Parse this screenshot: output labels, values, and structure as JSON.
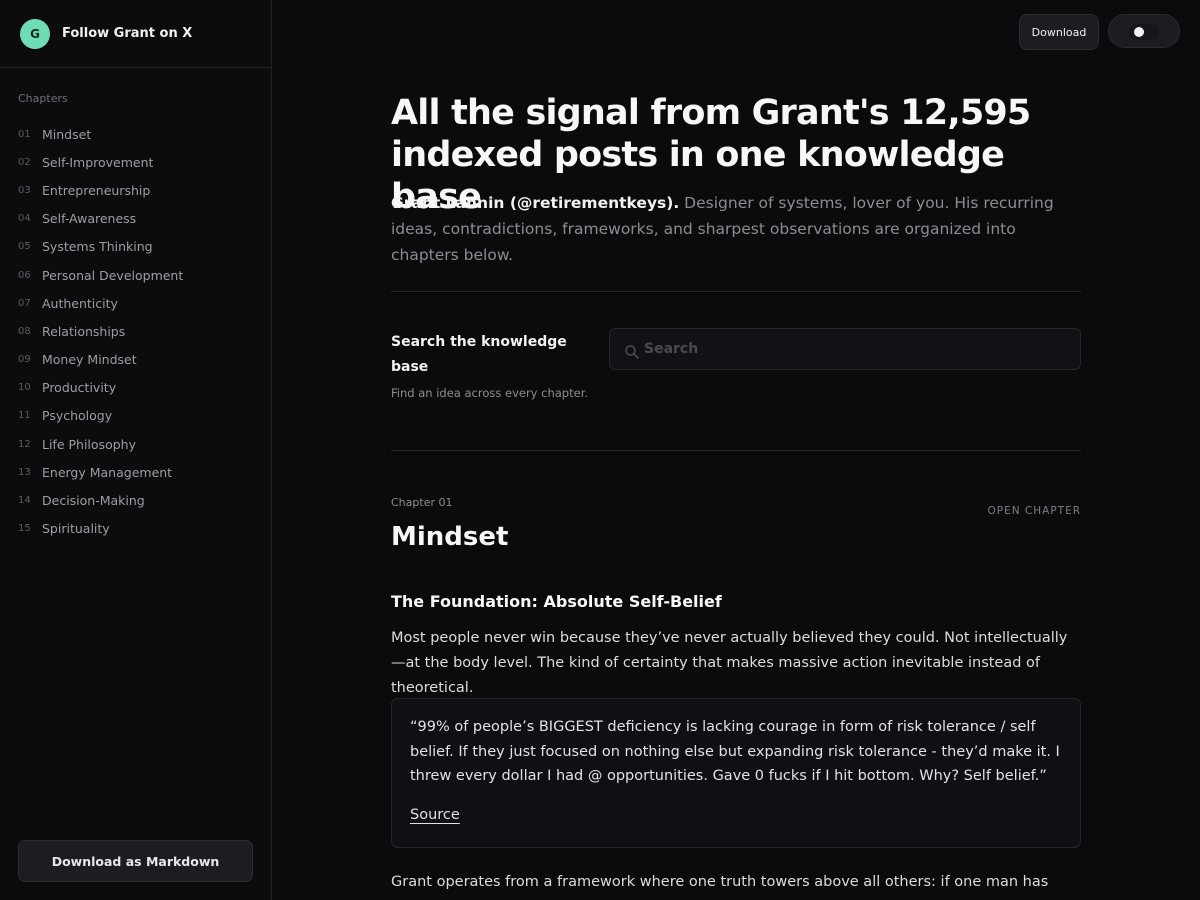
{
  "sidebar": {
    "avatar_letter": "G",
    "follow_label": "Follow Grant on X",
    "section_label": "Chapters",
    "chapters": [
      {
        "num": "01",
        "label": "Mindset"
      },
      {
        "num": "02",
        "label": "Self-Improvement"
      },
      {
        "num": "03",
        "label": "Entrepreneurship"
      },
      {
        "num": "04",
        "label": "Self-Awareness"
      },
      {
        "num": "05",
        "label": "Systems Thinking"
      },
      {
        "num": "06",
        "label": "Personal Development"
      },
      {
        "num": "07",
        "label": "Authenticity"
      },
      {
        "num": "08",
        "label": "Relationships"
      },
      {
        "num": "09",
        "label": "Money Mindset"
      },
      {
        "num": "10",
        "label": "Productivity"
      },
      {
        "num": "11",
        "label": "Psychology"
      },
      {
        "num": "12",
        "label": "Life Philosophy"
      },
      {
        "num": "13",
        "label": "Energy Management"
      },
      {
        "num": "14",
        "label": "Decision-Making"
      },
      {
        "num": "15",
        "label": "Spirituality"
      }
    ],
    "download_label": "Download as Markdown"
  },
  "topbar": {
    "download_label": "Download",
    "theme_toggle": "off"
  },
  "hero": {
    "title": "All the signal from Grant's 12,595 indexed posts in one knowledge base",
    "author": "Grant Lannin (@retirementkeys).",
    "description": " Designer of systems, lover of you. His recurring ideas, contradictions, frameworks, and sharpest observations are organized into chapters below."
  },
  "search": {
    "title": "Search the knowledge base",
    "hint": "Find an idea across every chapter.",
    "placeholder": "Search",
    "value": ""
  },
  "chapter": {
    "label": "Chapter 01",
    "open_label": "OPEN CHAPTER",
    "title": "Mindset",
    "section_heading": "The Foundation: Absolute Self-Belief",
    "paragraph1": "Most people never win because they’ve never actually believed they could. Not intellectually—at the body level. The kind of certainty that makes massive action inevitable instead of theoretical.",
    "quote": "“99% of people’s BIGGEST deficiency is lacking courage in form of risk tolerance / self belief. If they just focused on nothing else but expanding risk tolerance - they’d make it. I threw every dollar I had @ opportunities. Gave 0 fucks if I hit bottom. Why? Self belief.”",
    "quote_source": "Source",
    "paragraph2": "Grant operates from a framework where one truth towers above all others: if one man has done"
  },
  "colors": {
    "background": "#0b0b0d",
    "sidebar": "#0c0c0f",
    "avatar": "#6fdcb5",
    "text_primary": "#f7f7f9",
    "text_muted": "#8c8c95"
  }
}
